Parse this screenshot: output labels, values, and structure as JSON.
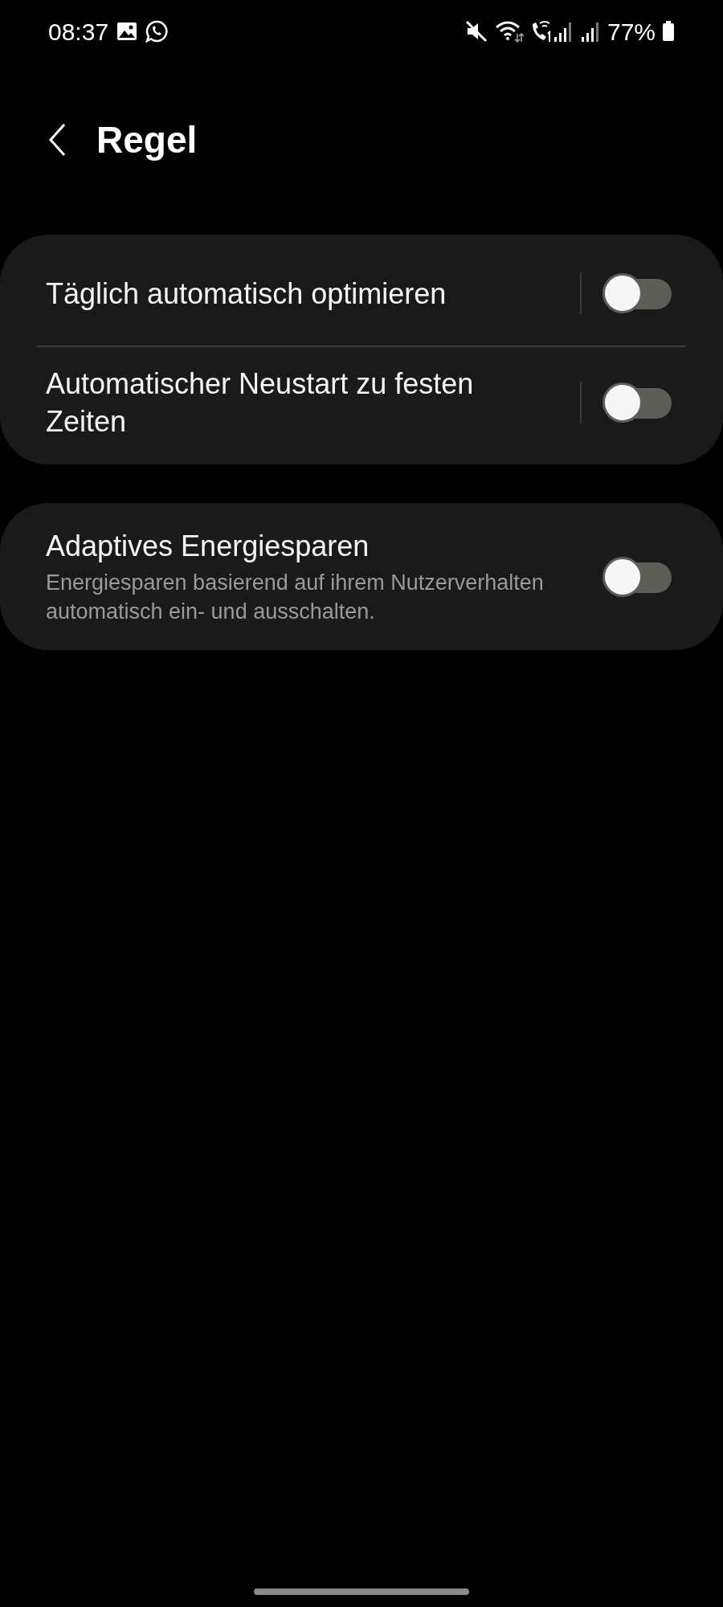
{
  "status_bar": {
    "time": "08:37",
    "battery": "77%"
  },
  "header": {
    "title": "Regel"
  },
  "groups": [
    {
      "items": [
        {
          "kind": "split",
          "title": "Täglich automatisch optimieren",
          "on": false
        },
        {
          "kind": "split",
          "title": "Automatischer Neustart zu festen Zeiten",
          "on": false
        }
      ]
    },
    {
      "items": [
        {
          "kind": "switch",
          "title": "Adaptives Energiesparen",
          "subtitle": "Energiesparen basierend auf ihrem Nutzerverhalten automatisch ein- und ausschalten.",
          "on": false
        }
      ]
    }
  ]
}
